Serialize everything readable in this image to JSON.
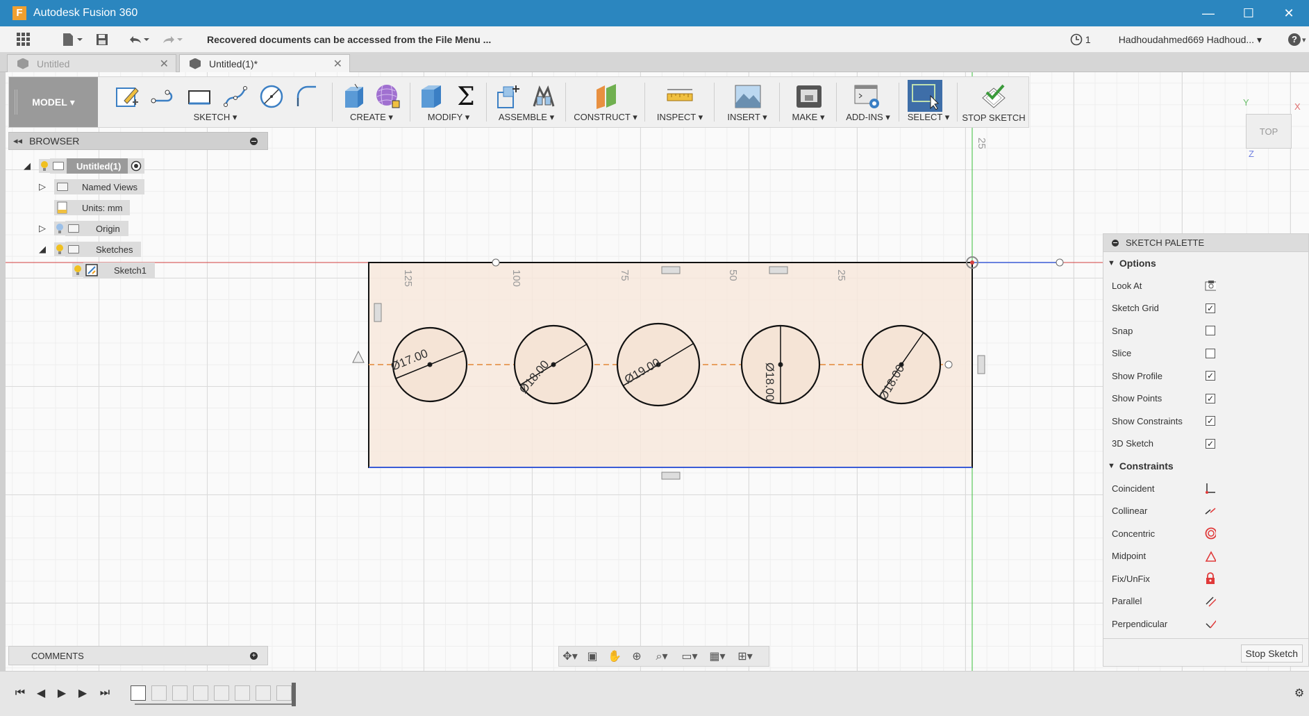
{
  "window": {
    "title": "Autodesk Fusion 360",
    "app_logo": "F",
    "minimize": "—",
    "maximize": "☐",
    "close": "✕"
  },
  "quickbar": {
    "notice": "Recovered documents can be accessed from the File Menu ...",
    "jobs_count": "1",
    "user": "Hadhoudahmed669 Hadhoud...",
    "help": "?"
  },
  "tabs": [
    {
      "label": "Untitled",
      "active": false
    },
    {
      "label": "Untitled(1)*",
      "active": true
    }
  ],
  "toolbar": {
    "model_label": "MODEL",
    "groups": {
      "sketch": "SKETCH",
      "create": "CREATE",
      "modify": "MODIFY",
      "assemble": "ASSEMBLE",
      "construct": "CONSTRUCT",
      "inspect": "INSPECT",
      "insert": "INSERT",
      "make": "MAKE",
      "addins": "ADD-INS",
      "select": "SELECT",
      "stop_sketch": "STOP SKETCH"
    }
  },
  "browser": {
    "title": "BROWSER",
    "root": "Untitled(1)",
    "nodes": {
      "named_views": "Named Views",
      "units": "Units: mm",
      "origin": "Origin",
      "sketches": "Sketches",
      "sketch1": "Sketch1"
    }
  },
  "sketch": {
    "ruler_labels": [
      "125",
      "100",
      "75",
      "50",
      "25"
    ],
    "vertical_ruler_label": "25",
    "dimensions": [
      "Ø17.00",
      "Ø18.00",
      "Ø19.00",
      "Ø18.00",
      "Ø18.00"
    ]
  },
  "palette": {
    "title": "SKETCH PALETTE",
    "options_title": "Options",
    "options": [
      {
        "label": "Look At",
        "type": "icon",
        "icon": "look-at-icon"
      },
      {
        "label": "Sketch Grid",
        "checked": true
      },
      {
        "label": "Snap",
        "checked": false
      },
      {
        "label": "Slice",
        "checked": false
      },
      {
        "label": "Show Profile",
        "checked": true
      },
      {
        "label": "Show Points",
        "checked": true
      },
      {
        "label": "Show Constraints",
        "checked": true
      },
      {
        "label": "3D Sketch",
        "checked": true
      }
    ],
    "constraints_title": "Constraints",
    "constraints": [
      {
        "label": "Coincident",
        "icon": "coincident-icon"
      },
      {
        "label": "Collinear",
        "icon": "collinear-icon"
      },
      {
        "label": "Concentric",
        "icon": "concentric-icon"
      },
      {
        "label": "Midpoint",
        "icon": "midpoint-icon"
      },
      {
        "label": "Fix/UnFix",
        "icon": "lock-icon"
      },
      {
        "label": "Parallel",
        "icon": "parallel-icon"
      },
      {
        "label": "Perpendicular",
        "icon": "perpendicular-icon"
      }
    ],
    "stop_button": "Stop Sketch"
  },
  "comments": {
    "title": "COMMENTS"
  },
  "viewcube": {
    "face": "TOP",
    "x_axis": "X",
    "y_axis": "Y",
    "z_axis": "Z"
  },
  "colors": {
    "titlebar": "#2b86bf",
    "accent_red": "#e03a3a",
    "sketch_fill": "#f7e8dc",
    "axis_green": "#3bbf3b",
    "axis_red": "#d24040",
    "axis_blue": "#3a5bd6"
  }
}
